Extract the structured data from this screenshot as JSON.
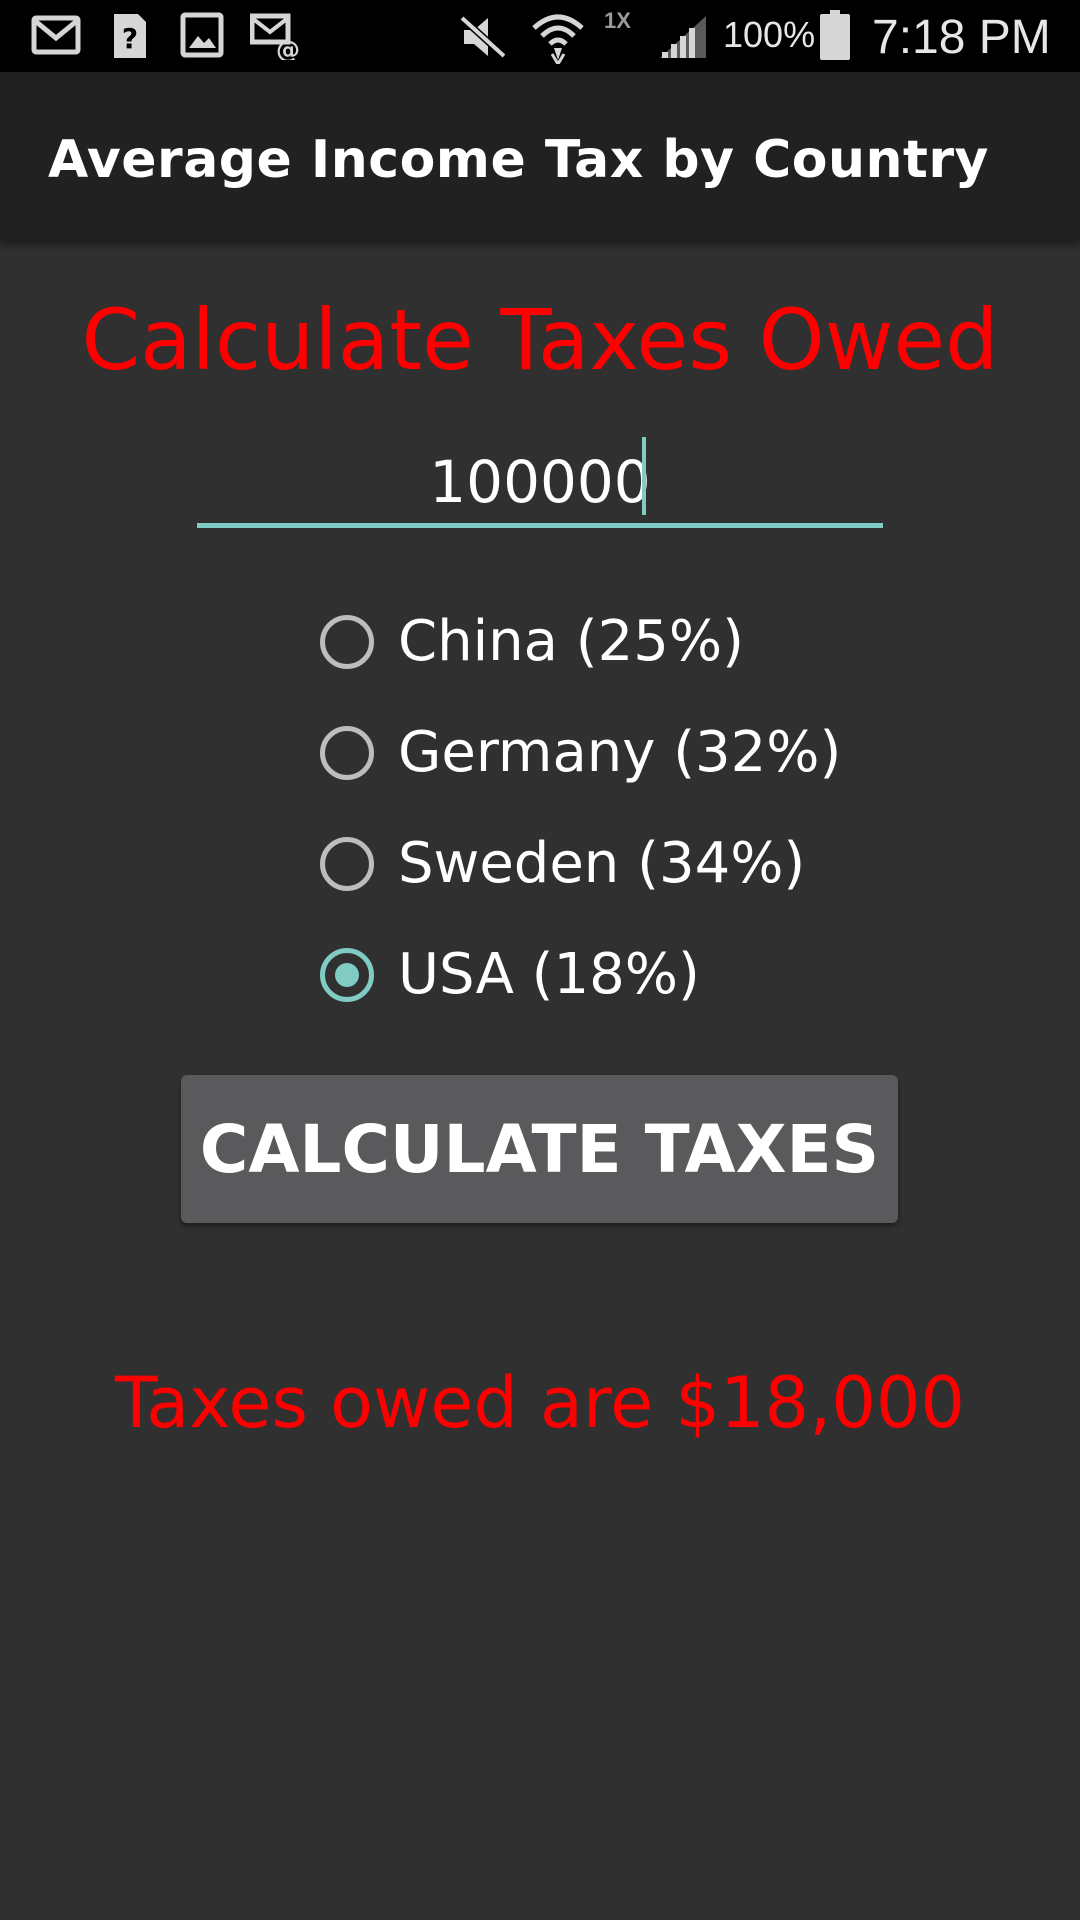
{
  "status_bar": {
    "icons": [
      "gmail-icon",
      "help-icon",
      "gallery-icon",
      "email-icon",
      "mute-icon",
      "wifi-icon",
      "signal-icon",
      "battery-icon"
    ],
    "network_type": "1X",
    "battery_percent": "100%",
    "time": "7:18 PM"
  },
  "app_bar": {
    "title": "Average Income Tax by Country"
  },
  "main": {
    "heading": "Calculate Taxes Owed",
    "income_input": {
      "value": "100000",
      "placeholder": ""
    },
    "countries": [
      {
        "label": "China (25%)",
        "checked": false
      },
      {
        "label": "Germany (32%)",
        "checked": false
      },
      {
        "label": "Sweden (34%)",
        "checked": false
      },
      {
        "label": "USA (18%)",
        "checked": true
      }
    ],
    "calculate_button_label": "CALCULATE TAXES",
    "result": "Taxes owed are $18,000"
  },
  "colors": {
    "background": "#303030",
    "app_bar": "#212121",
    "accent": "#80cbc4",
    "heading_red": "#ff0000",
    "button": "#5a5a5c"
  }
}
